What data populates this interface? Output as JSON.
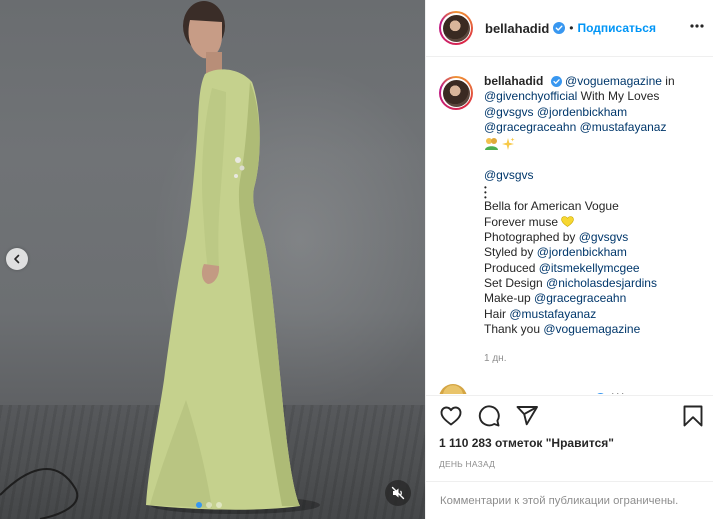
{
  "post": {
    "author": "bellahadid",
    "follow_sep": "•",
    "follow_label": "Подписаться",
    "caption": {
      "line1_mention": "@voguemagazine",
      "line1_text": " in",
      "line2_mention": "@givenchyofficial",
      "line2_text": " With My Loves",
      "line3_m1": "@gvsgvs",
      "line3_m2": "@jordenbickham",
      "line4_m1": "@gracegraceahn",
      "line4_m2": "@mustafayanaz",
      "line5_mention": "@gvsgvs",
      "dots": "•\n•\n•",
      "line6": "Bella for American Vogue",
      "line7": "Forever muse",
      "line8_label": "Photographed by ",
      "line8_mention": "@gvsgvs",
      "line9_label": "Styled by ",
      "line9_mention": "@jordenbickham",
      "line10_label": "Produced ",
      "line10_mention": "@itsmekellymcgee",
      "line11_label": "Set Design ",
      "line11_mention": "@nicholasdesjardins",
      "line12_label": "Make-up ",
      "line12_mention": "@gracegraceahn",
      "line13_label": "Hair ",
      "line13_mention": "@mustafayanaz",
      "line14_label": "Thank you ",
      "line14_mention": "@voguemagazine"
    },
    "time_ago": "1 дн.",
    "next_comment_text": "W",
    "likes_text": "1 110 283 отметок \"Нравится\"",
    "date_text": "ДЕНЬ НАЗАД",
    "comments_restricted": "Комментарии к этой публикации ограничены."
  },
  "media": {
    "carousel": {
      "total": 3,
      "active": 1
    }
  },
  "icons": {
    "header_more": "more-horizontal-icon",
    "like": "heart-outline-icon",
    "comment": "speech-bubble-icon",
    "share": "paper-plane-icon",
    "save": "bookmark-icon",
    "mute": "speaker-muted-icon",
    "prev": "chevron-left-icon",
    "verified": "verified-badge-icon"
  },
  "colors": {
    "accent": "#0095f6",
    "link": "#00376b",
    "muted_text": "#8e8e8e",
    "divider": "#efefef",
    "verified": "#3897f0",
    "heart_emoji": "#f7d731"
  }
}
